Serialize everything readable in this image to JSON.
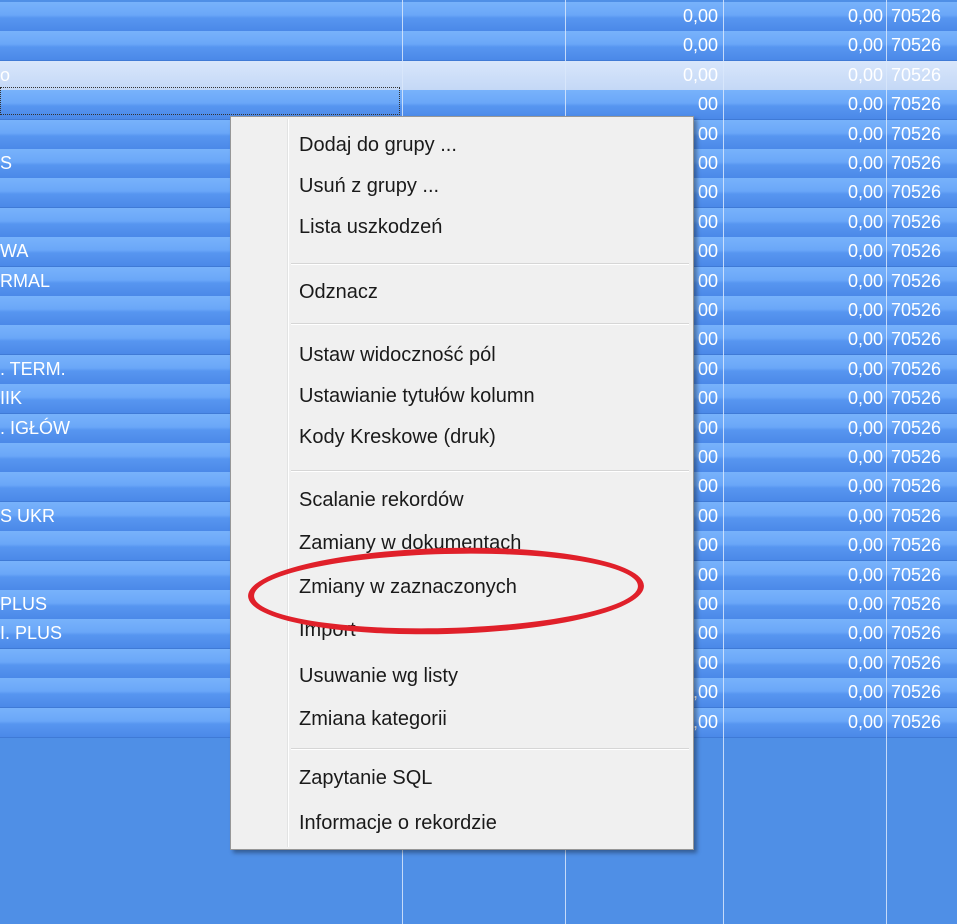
{
  "grid": {
    "rows": [
      {
        "name": "",
        "v1": "0,00",
        "v2": "0,00",
        "code": "70526"
      },
      {
        "name": "",
        "v1": "0,00",
        "v2": "0,00",
        "code": "70526"
      },
      {
        "name": "o",
        "v1": "0,00",
        "v2": "0,00",
        "code": "70526",
        "selected": true
      },
      {
        "name": "",
        "v1": "00",
        "v2": "0,00",
        "code": "70526"
      },
      {
        "name": "",
        "v1": "00",
        "v2": "0,00",
        "code": "70526"
      },
      {
        "name": "S",
        "v1": "00",
        "v2": "0,00",
        "code": "70526"
      },
      {
        "name": "",
        "v1": "00",
        "v2": "0,00",
        "code": "70526"
      },
      {
        "name": "",
        "v1": "00",
        "v2": "0,00",
        "code": "70526"
      },
      {
        "name": "WA",
        "v1": "00",
        "v2": "0,00",
        "code": "70526"
      },
      {
        "name": "RMAL",
        "v1": "00",
        "v2": "0,00",
        "code": "70526"
      },
      {
        "name": "",
        "v1": "00",
        "v2": "0,00",
        "code": "70526"
      },
      {
        "name": "",
        "v1": "00",
        "v2": "0,00",
        "code": "70526"
      },
      {
        "name": ". TERM.",
        "v1": "00",
        "v2": "0,00",
        "code": "70526"
      },
      {
        "name": "IIK",
        "v1": "00",
        "v2": "0,00",
        "code": "70526"
      },
      {
        "name": ". IGŁÓW",
        "v1": "00",
        "v2": "0,00",
        "code": "70526"
      },
      {
        "name": "",
        "v1": "00",
        "v2": "0,00",
        "code": "70526"
      },
      {
        "name": "",
        "v1": "00",
        "v2": "0,00",
        "code": "70526"
      },
      {
        "name": "S UKR",
        "v1": "00",
        "v2": "0,00",
        "code": "70526"
      },
      {
        "name": "",
        "v1": "00",
        "v2": "0,00",
        "code": "70526"
      },
      {
        "name": "",
        "v1": "00",
        "v2": "0,00",
        "code": "70526"
      },
      {
        "name": "PLUS",
        "v1": "00",
        "v2": "0,00",
        "code": "70526"
      },
      {
        "name": "I. PLUS",
        "v1": "00",
        "v2": "0,00",
        "code": "70526"
      },
      {
        "name": "",
        "v1": "00",
        "v2": "0,00",
        "code": "70526"
      },
      {
        "name": "",
        "v1": "0,00",
        "v2": "0,00",
        "code": "70526"
      },
      {
        "name": "",
        "v1": "0,00",
        "v2": "0,00",
        "code": "70526"
      }
    ]
  },
  "context_menu": {
    "items": [
      {
        "label": "Dodaj do grupy ..."
      },
      {
        "label": "Usuń z grupy ..."
      },
      {
        "label": "Lista uszkodzeń"
      },
      {
        "label": "Odznacz"
      },
      {
        "label": "Ustaw widoczność pól"
      },
      {
        "label": "Ustawianie tytułów kolumn"
      },
      {
        "label": "Kody Kreskowe (druk)"
      },
      {
        "label": "Scalanie rekordów"
      },
      {
        "label": "Zamiany w dokumentach"
      },
      {
        "label": "Zmiany w zaznaczonych",
        "highlighted_by_annotation": true
      },
      {
        "label": "Import"
      },
      {
        "label": "Usuwanie wg listy"
      },
      {
        "label": "Zmiana kategorii"
      },
      {
        "label": "Zapytanie SQL"
      },
      {
        "label": "Informacje o rekordzie"
      }
    ]
  },
  "annotation": {
    "shape": "ellipse",
    "color": "#e0202a"
  },
  "colors": {
    "row_blue": "#6aa7f8",
    "selected_row": "#d0e1f9",
    "menu_bg": "#f0f0f0"
  }
}
